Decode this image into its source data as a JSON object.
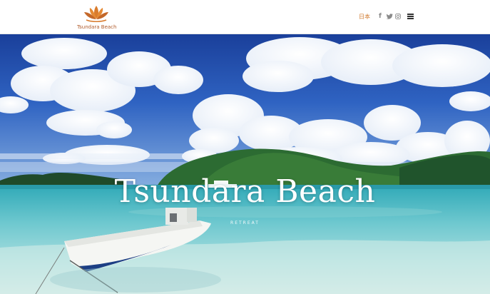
{
  "brand": {
    "logo_text": "Tsundara Beach",
    "accent_color": "#d07a2e"
  },
  "header": {
    "language": "日本",
    "social": [
      {
        "name": "facebook",
        "icon": "facebook-icon",
        "glyph": "f"
      },
      {
        "name": "twitter",
        "icon": "twitter-icon",
        "glyph": "twitter-bird"
      },
      {
        "name": "instagram",
        "icon": "instagram-icon",
        "glyph": "instagram-camera"
      }
    ],
    "menu_icon": "hamburger-menu-icon"
  },
  "hero": {
    "title": "Tsundara Beach",
    "subtitle": "RETREAT"
  }
}
